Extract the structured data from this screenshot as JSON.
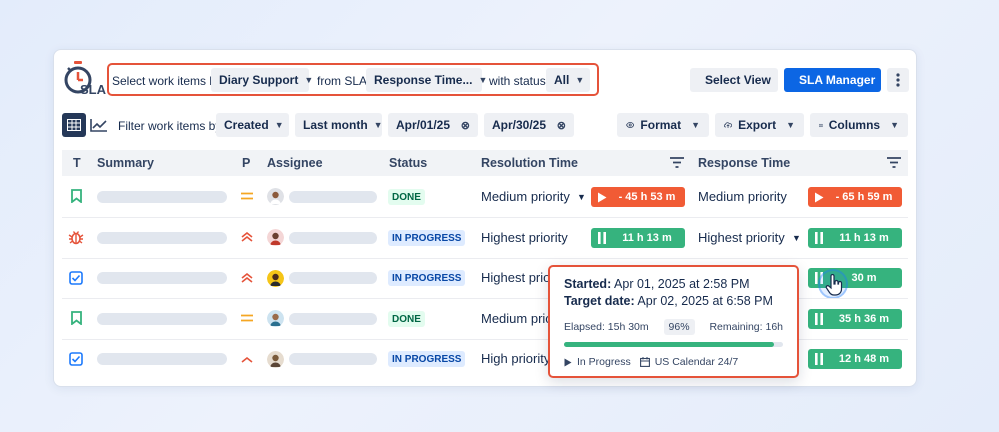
{
  "toolbar": {
    "select_label": "Select work items by:",
    "select_value": "Diary Support",
    "from_sla_label": "from SLA:",
    "sla_value": "Response Time...",
    "status_label": "with status:",
    "status_value": "All",
    "select_view": "Select View",
    "sla_manager": "SLA Manager",
    "logo_text": "SLA"
  },
  "filters": {
    "label": "Filter work items by:",
    "field": "Created",
    "period": "Last month",
    "date_from": "Apr/01/25",
    "date_to": "Apr/30/25",
    "format": "Format",
    "export": "Export",
    "columns": "Columns"
  },
  "table": {
    "headers": {
      "type": "T",
      "summary": "Summary",
      "priority": "P",
      "assignee": "Assignee",
      "status": "Status",
      "resolution": "Resolution Time",
      "response": "Response Time"
    },
    "rows": [
      {
        "type": "bookmark-icon",
        "status": "DONE",
        "res_prio": "Medium priority",
        "res_timer": "- 45 h 53 m",
        "resp_prio": "Medium priority",
        "resp_timer": "- 65 h 59 m"
      },
      {
        "type": "bug-icon",
        "status": "IN PROGRESS",
        "res_prio": "Highest priority",
        "res_timer": "11 h 13 m",
        "resp_prio": "Highest priority",
        "resp_timer": "11 h 13 m"
      },
      {
        "type": "checkbox-icon",
        "status": "IN PROGRESS",
        "res_prio": "Highest prior",
        "res_timer": "",
        "resp_prio": "",
        "resp_timer": "30 m"
      },
      {
        "type": "bookmark-icon",
        "status": "DONE",
        "res_prio": "Medium prior",
        "res_timer": "",
        "resp_prio": "",
        "resp_timer": "35 h 36 m"
      },
      {
        "type": "checkbox-icon",
        "status": "IN PROGRESS",
        "res_prio": "High priority",
        "res_timer": "",
        "resp_prio": "",
        "resp_timer": "12 h 48 m"
      }
    ]
  },
  "tooltip": {
    "started_label": "Started:",
    "started_value": "Apr 01, 2025 at 2:58 PM",
    "target_label": "Target date:",
    "target_value": "Apr 02, 2025 at 6:58 PM",
    "elapsed": "Elapsed: 15h 30m",
    "percent": "96%",
    "progress_fraction": 0.96,
    "remaining": "Remaining: 16h",
    "state": "In Progress",
    "calendar": "US Calendar 24/7"
  },
  "colors": {
    "primary": "#0c66e4",
    "timer_red": "#f15b35",
    "timer_green": "#36b37e",
    "highlight": "#e5533a"
  }
}
